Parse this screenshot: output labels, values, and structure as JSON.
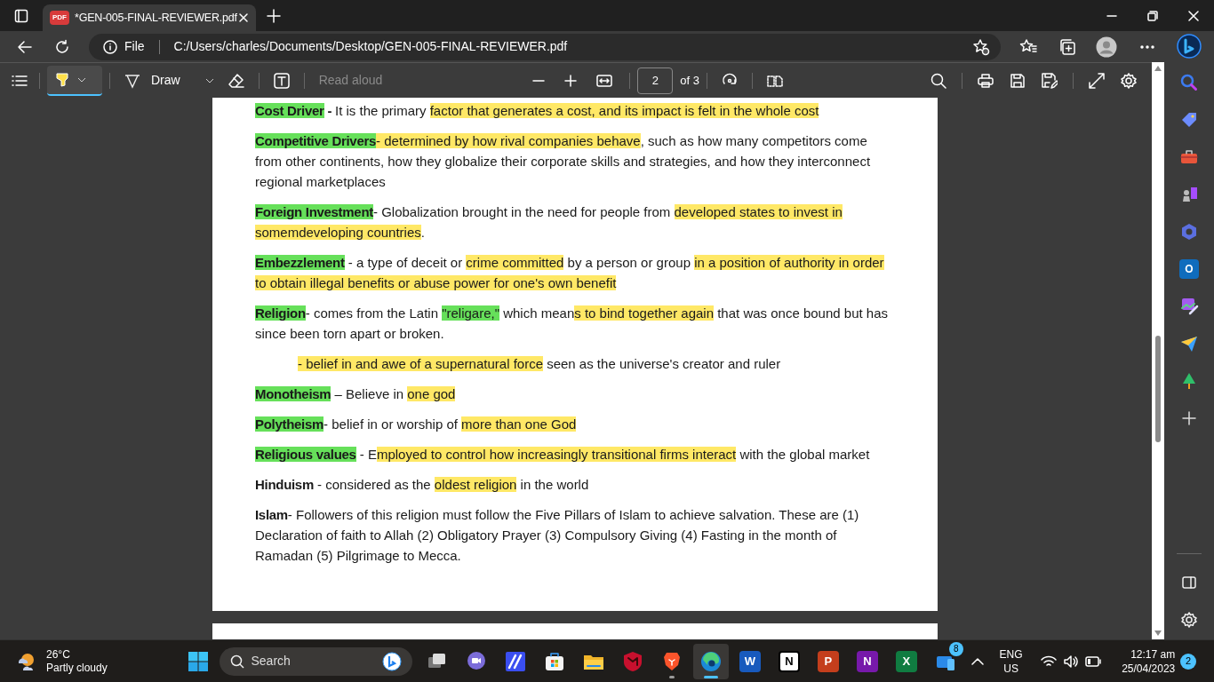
{
  "window": {
    "tab": {
      "title": "*GEN-005-FINAL-REVIEWER.pdf",
      "icon_glyph": "PDF",
      "selected": true
    }
  },
  "address_bar": {
    "scheme": "File",
    "url": "C:/Users/charles/Documents/Desktop/GEN-005-FINAL-REVIEWER.pdf"
  },
  "pdf_toolbar": {
    "highlight_selected": true,
    "draw_label": "Draw",
    "read_aloud": {
      "label": "Read aloud",
      "disabled": true
    },
    "page": {
      "value": "2",
      "total": "of 3"
    }
  },
  "document": {
    "paragraphs": [
      {
        "indent": false,
        "segments": [
          {
            "text": "Cost Driver",
            "bold": true,
            "color": "#66e05a"
          },
          {
            "text": " - ",
            "bold": true
          },
          {
            "text": "It is the primary "
          },
          {
            "text": "factor that generates a cost, and its impact is felt in the whole cost",
            "color": "#ffe866"
          }
        ]
      },
      {
        "indent": false,
        "segments": [
          {
            "text": "Competitive Drivers",
            "bold": true,
            "color": "#66e05a"
          },
          {
            "text": "- determined by how rival companies behave",
            "color": "#ffe866"
          },
          {
            "text": ", such as how many competitors come from other continents, how they globalize their corporate skills and strategies, and how they interconnect regional marketplaces"
          }
        ]
      },
      {
        "indent": false,
        "segments": [
          {
            "text": "Foreign Investment",
            "bold": true,
            "color": "#66e05a"
          },
          {
            "text": "- Globalization brought in the need for people from "
          },
          {
            "text": "developed states to invest in somemdeveloping countries",
            "color": "#ffe866"
          },
          {
            "text": "."
          }
        ]
      },
      {
        "indent": false,
        "segments": [
          {
            "text": "Embezzlement",
            "bold": true,
            "color": "#66e05a"
          },
          {
            "text": " - a type of deceit or "
          },
          {
            "text": "crime committed",
            "color": "#ffe866"
          },
          {
            "text": " by a person or group "
          },
          {
            "text": "in a position of authority in order to obtain illegal benefits or abuse power for one's own benefit",
            "color": "#ffe866"
          }
        ]
      },
      {
        "indent": false,
        "segments": [
          {
            "text": "Religion",
            "bold": true,
            "color": "#66e05a"
          },
          {
            "text": "- comes from the Latin "
          },
          {
            "text": "\"religare,\"",
            "color": "#66e05a"
          },
          {
            "text": " which mean"
          },
          {
            "text": "s to bind together again",
            "color": "#ffe866"
          },
          {
            "text": " that was once bound but has since been torn apart or broken."
          }
        ]
      },
      {
        "indent": true,
        "segments": [
          {
            "text": "- belief in and awe of a supernatural force",
            "color": "#ffe866"
          },
          {
            "text": " seen as the universe's creator and ruler"
          }
        ]
      },
      {
        "indent": false,
        "segments": [
          {
            "text": "Monotheism",
            "bold": true,
            "color": "#66e05a"
          },
          {
            "text": " – Believe in "
          },
          {
            "text": "one god",
            "color": "#ffe866"
          }
        ]
      },
      {
        "indent": false,
        "segments": [
          {
            "text": "Polytheism",
            "bold": true,
            "color": "#66e05a"
          },
          {
            "text": "- belief in or worship of "
          },
          {
            "text": "more than one God",
            "color": "#ffe866"
          }
        ]
      },
      {
        "indent": false,
        "segments": [
          {
            "text": "Religious values",
            "bold": true,
            "color": "#66e05a"
          },
          {
            "text": " - E"
          },
          {
            "text": "mployed to control how increasingly transitional firms interact",
            "color": "#ffe866"
          },
          {
            "text": " with the global market"
          }
        ]
      },
      {
        "indent": false,
        "segments": [
          {
            "text": "Hinduism",
            "bold": true
          },
          {
            "text": " - considered as the "
          },
          {
            "text": "oldest religion",
            "color": "#ffe866"
          },
          {
            "text": " in the world"
          }
        ]
      },
      {
        "indent": false,
        "segments": [
          {
            "text": "Islam",
            "bold": true
          },
          {
            "text": "- Followers of this religion must follow the Five Pillars of Islam to achieve salvation. These are (1) Declaration of faith to Allah (2) Obligatory Prayer (3) Compulsory Giving (4) Fasting in the month of Ramadan (5) Pilgrimage to Mecca."
          }
        ]
      }
    ]
  },
  "sidebar": {
    "items": [
      {
        "kind": "search"
      },
      {
        "kind": "tag"
      },
      {
        "kind": "toolbox"
      },
      {
        "kind": "chess"
      },
      {
        "kind": "hexagon"
      },
      {
        "kind": "mail",
        "glyph": "O"
      },
      {
        "kind": "image-edit"
      },
      {
        "kind": "paper-plane"
      },
      {
        "kind": "tree"
      },
      {
        "kind": "add"
      }
    ]
  },
  "taskbar": {
    "weather": {
      "temperature": "26°C",
      "condition": "Partly cloudy"
    },
    "search_placeholder": "Search",
    "apps": [
      {
        "kind": "task-view",
        "running": false,
        "selected": false
      },
      {
        "kind": "video-chat",
        "running": false,
        "selected": false
      },
      {
        "kind": "slash-tile",
        "running": false,
        "selected": false
      },
      {
        "kind": "store",
        "running": false,
        "selected": false
      },
      {
        "kind": "folder",
        "running": false,
        "selected": false
      },
      {
        "kind": "shield",
        "running": false,
        "selected": false
      },
      {
        "kind": "lion",
        "running": true,
        "selected": false
      },
      {
        "kind": "browser",
        "running": true,
        "selected": true
      },
      {
        "kind": "letter-tile",
        "glyph": "W",
        "color": "#185abd",
        "running": false,
        "selected": false
      },
      {
        "kind": "letter-tile",
        "glyph": "N",
        "color": "#ffffff",
        "running": false,
        "selected": false
      },
      {
        "kind": "letter-tile",
        "glyph": "P",
        "color": "#c43e1c",
        "running": false,
        "selected": false
      },
      {
        "kind": "letter-tile",
        "glyph": "N",
        "color": "#7719aa",
        "running": false,
        "selected": false
      },
      {
        "kind": "letter-tile",
        "glyph": "X",
        "color": "#107c41",
        "running": false,
        "selected": false
      },
      {
        "kind": "phone",
        "badge": "8",
        "running": false,
        "selected": false
      }
    ],
    "language": "ENG",
    "region": "US",
    "time": "12:17 am",
    "date": "25/04/2023",
    "notifications": "2"
  }
}
